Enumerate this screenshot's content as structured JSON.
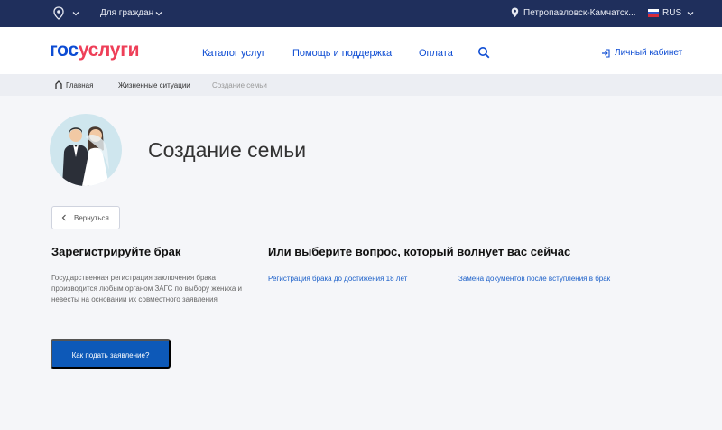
{
  "topbar": {
    "audience": "Для граждан",
    "location": "Петропавловск-Камчатск...",
    "language": "RUS"
  },
  "header": {
    "logo_part1": "гос",
    "logo_part2": "услуги",
    "nav": [
      "Каталог услуг",
      "Помощь и поддержка",
      "Оплата"
    ],
    "cabinet": "Личный кабинет"
  },
  "breadcrumbs": [
    "Главная",
    "Жизненные ситуации",
    "Создание семьи"
  ],
  "main": {
    "title": "Создание семьи",
    "back_label": "Вернуться",
    "register_heading": "Зарегистрируйте брак",
    "register_text": "Государственная регистрация заключения брака производится любым органом ЗАГС по выбору жениха и невесты на основании их совместного заявления",
    "apply_button": "Как подать заявление?",
    "questions_heading": "Или выберите вопрос, который волнует вас сейчас",
    "questions": [
      "Регистрация брака до достижения 18 лет",
      "Замена документов после вступления в брак"
    ]
  },
  "colors": {
    "topbar": "#1f2f5c",
    "brand_blue": "#0d4cd3",
    "brand_red": "#ee3f58",
    "button": "#0d59b8"
  }
}
